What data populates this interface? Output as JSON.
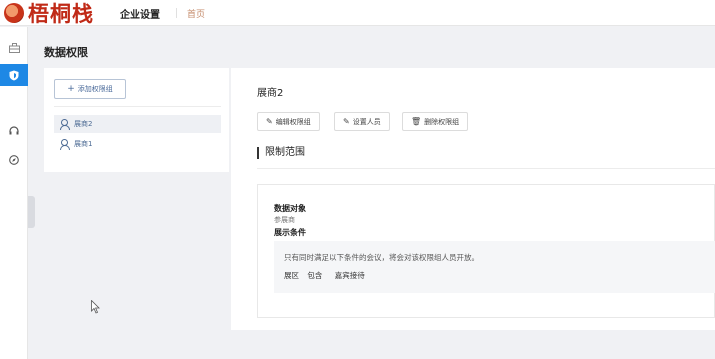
{
  "header": {
    "logo_text": "梧桐栈",
    "nav_active": "企业设置",
    "nav_home": "首页"
  },
  "sidebar": {
    "items": [
      {
        "icon": "briefcase-icon",
        "active": false
      },
      {
        "icon": "shield-icon",
        "active": true
      },
      {
        "icon": "headset-icon",
        "active": false
      },
      {
        "icon": "compass-icon",
        "active": false
      }
    ]
  },
  "page": {
    "title": "数据权限"
  },
  "groups": {
    "add_label": "添加权限组",
    "items": [
      {
        "label": "展商2",
        "selected": true
      },
      {
        "label": "展商1",
        "selected": false
      }
    ]
  },
  "detail": {
    "title": "展商2",
    "buttons": [
      {
        "icon": "edit-icon",
        "label": "编辑权限组"
      },
      {
        "icon": "edit-icon",
        "label": "设置人员"
      },
      {
        "icon": "trash-icon",
        "label": "删除权限组"
      }
    ],
    "section_title": "限制范围",
    "rule": {
      "object_label": "数据对象",
      "object_value": "参展商",
      "condition_label": "展示条件",
      "condition_note": "只有同时满足以下条件的会议，将会对该权限组人员开放。",
      "condition_field": "展区",
      "condition_op": "包含",
      "condition_value": "嘉宾接待"
    }
  },
  "colors": {
    "accent": "#1e88e5",
    "logo_red": "#c02a17"
  }
}
